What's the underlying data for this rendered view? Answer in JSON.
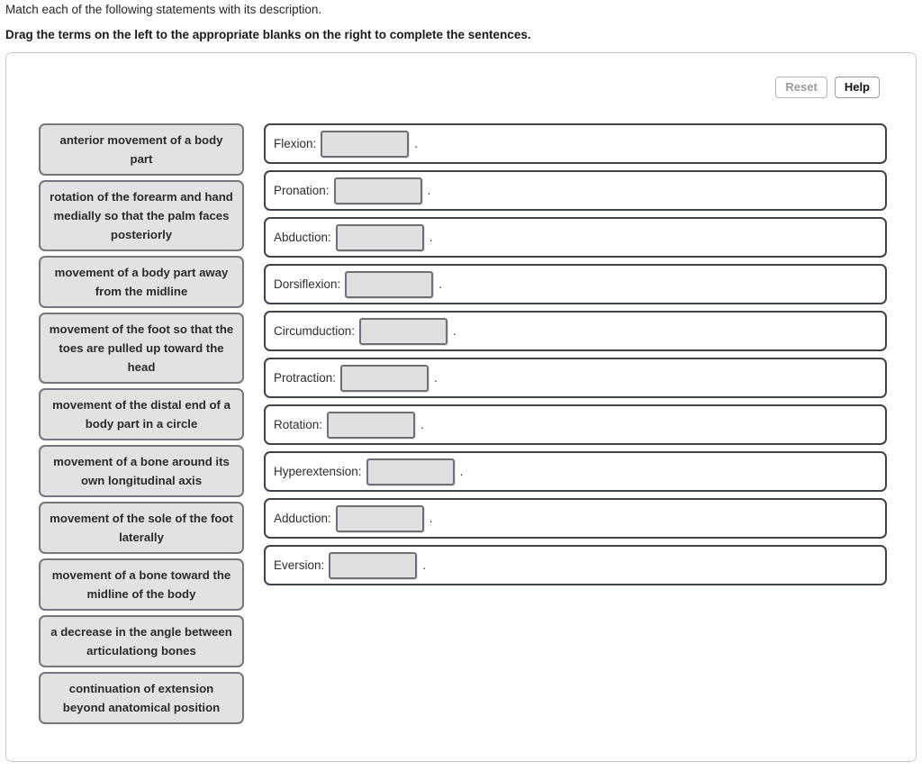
{
  "header": {
    "instruction_primary": "Match each of the following statements with its description.",
    "instruction_secondary": "Drag the terms on the left to the appropriate blanks on the right to complete the sentences."
  },
  "toolbar": {
    "reset_label": "Reset",
    "help_label": "Help"
  },
  "terms": [
    {
      "text": "anterior movement of a body part"
    },
    {
      "text": "rotation of the forearm and hand medially so that the palm faces posteriorly"
    },
    {
      "text": "movement of a body part away from the midline"
    },
    {
      "text": "movement of the foot so that the toes are pulled up toward the head"
    },
    {
      "text": "movement of the distal end of a body part in a circle"
    },
    {
      "text": "movement of a bone around its own longitudinal axis"
    },
    {
      "text": "movement of the sole of the foot laterally"
    },
    {
      "text": "movement of a bone toward the midline of the body"
    },
    {
      "text": "a decrease in the angle between articulationg bones"
    },
    {
      "text": "continuation of extension beyond anatomical position"
    }
  ],
  "banks": [
    {
      "label": "Flexion:",
      "value": "",
      "period": "."
    },
    {
      "label": "Pronation:",
      "value": "",
      "period": "."
    },
    {
      "label": "Abduction:",
      "value": "",
      "period": "."
    },
    {
      "label": "Dorsiflexion:",
      "value": "",
      "period": "."
    },
    {
      "label": "Circumduction:",
      "value": "",
      "period": "."
    },
    {
      "label": "Protraction:",
      "value": "",
      "period": "."
    },
    {
      "label": "Rotation:",
      "value": "",
      "period": "."
    },
    {
      "label": "Hyperextension:",
      "value": "",
      "period": "."
    },
    {
      "label": "Adduction:",
      "value": "",
      "period": "."
    },
    {
      "label": "Eversion:",
      "value": "",
      "period": "."
    }
  ],
  "colors": {
    "tile_fill": "#e2e2e2",
    "tile_border": "#76767f",
    "row_border": "#3d454b",
    "blank_fill": "#e0e0e0",
    "panel_border": "#c8c8c8"
  }
}
